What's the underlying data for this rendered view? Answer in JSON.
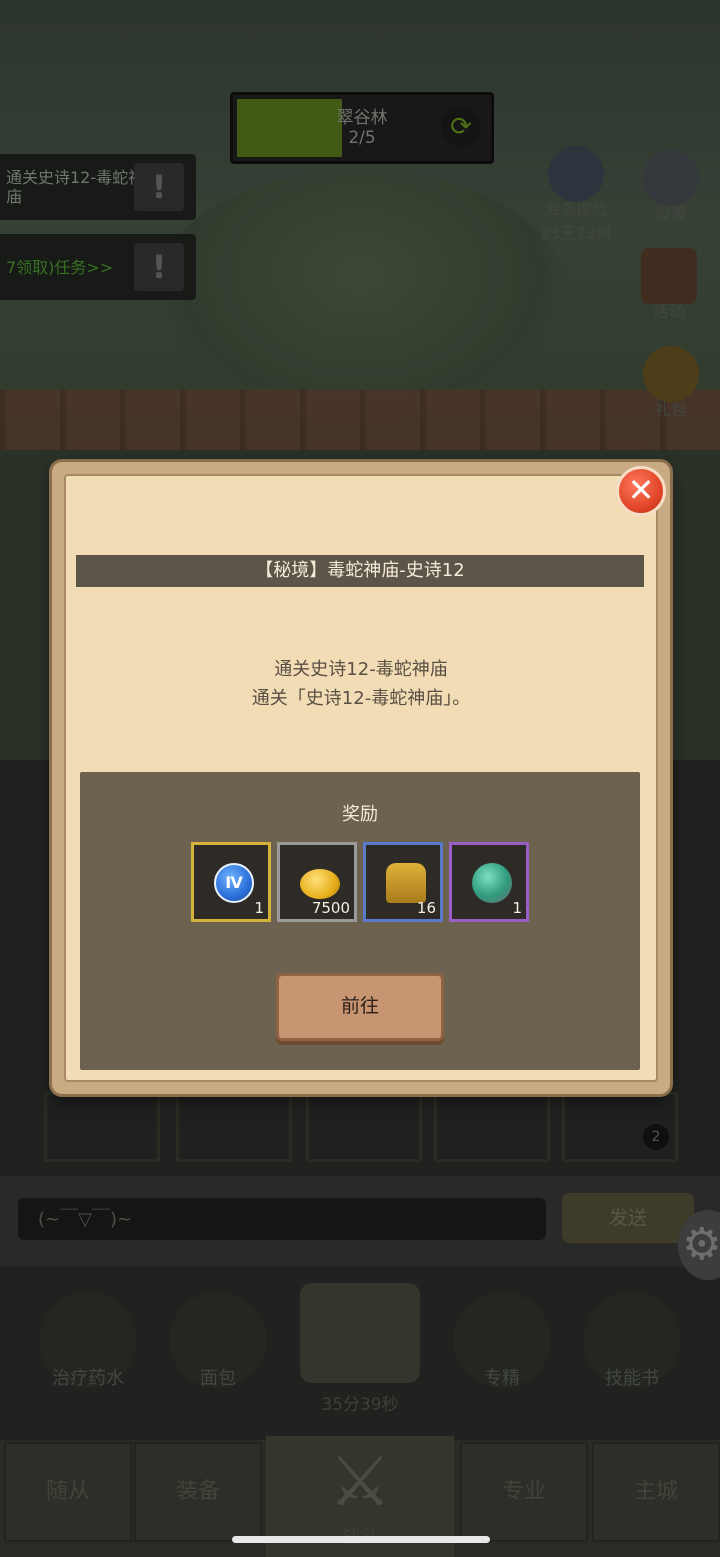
{
  "hud": {
    "stage_name": "翠谷林",
    "stage_progress": "2/5",
    "stage_fill_fraction": 0.42,
    "quests": [
      {
        "text": "通关史诗12-毒蛇神庙"
      },
      {
        "text": "7领取)任务>>"
      }
    ],
    "side_buttons": [
      {
        "label": "海岛探险",
        "sub": "23天23时",
        "icon": "anchor-icon"
      },
      {
        "label": "设置",
        "icon": "gear-icon"
      },
      {
        "label": "活动",
        "icon": "scroll-icon"
      },
      {
        "label": "礼包",
        "icon": "coin-chest-icon"
      }
    ]
  },
  "dialog": {
    "title": "【秘境】毒蛇神庙-史诗12",
    "desc_line1": "通关史诗12-毒蛇神庙",
    "desc_line2": "通关「史诗12-毒蛇神庙」。",
    "reward_title": "奖励",
    "rewards": [
      {
        "icon": "roman-four-medal-icon",
        "count": "1",
        "rarity_color": "#d5b33a"
      },
      {
        "icon": "gold-coin-icon",
        "count": "7500",
        "rarity_color": "#9a9a9a"
      },
      {
        "icon": "horned-helmet-icon",
        "count": "16",
        "rarity_color": "#5b79c9"
      },
      {
        "icon": "green-gem-icon",
        "count": "1",
        "rarity_color": "#9a5fc7"
      }
    ],
    "go_button": "前往"
  },
  "chat": {
    "input_text": "(~￣▽￣)~",
    "send_label": "发送"
  },
  "slot_badge": "2",
  "items": [
    {
      "label": "治疗药水",
      "icon": "potion-icon"
    },
    {
      "label": "面包",
      "icon": "bread-icon"
    },
    {
      "label": "专精",
      "icon": "specialty-icon"
    },
    {
      "label": "技能书",
      "icon": "skill-book-icon"
    }
  ],
  "chest_timer": "35分39秒",
  "nav": {
    "follower": "随从",
    "equipment": "装备",
    "battle": "战斗",
    "profession": "专业",
    "main_city": "主城"
  }
}
